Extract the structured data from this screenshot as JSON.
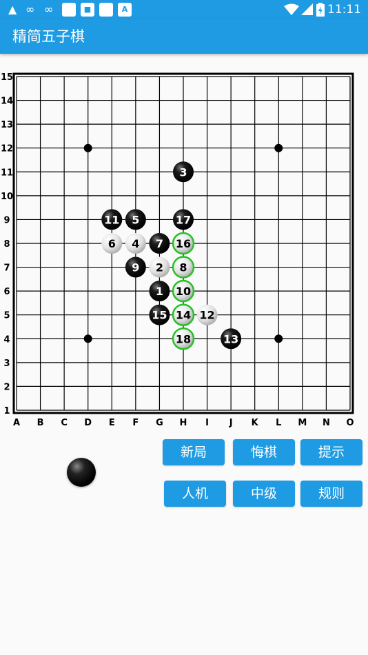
{
  "status_bar": {
    "time": "11:11",
    "left_icons": [
      "qq-icon",
      "infinity-icon",
      "infinity-icon",
      "square-app-icon",
      "robot-app-icon",
      "square-app-icon",
      "a-app-icon"
    ],
    "right_icons": [
      "wifi-icon",
      "signal-icon",
      "battery-icon"
    ]
  },
  "app": {
    "title": "精简五子棋"
  },
  "board": {
    "size": 15,
    "col_labels": [
      "A",
      "B",
      "C",
      "D",
      "E",
      "F",
      "G",
      "H",
      "I",
      "J",
      "K",
      "L",
      "M",
      "N",
      "O"
    ],
    "row_labels": [
      "15",
      "14",
      "13",
      "12",
      "11",
      "10",
      "9",
      "8",
      "7",
      "6",
      "5",
      "4",
      "3",
      "2",
      "1"
    ],
    "star_points": [
      [
        "D",
        12
      ],
      [
        "L",
        12
      ],
      [
        "D",
        4
      ],
      [
        "L",
        4
      ]
    ],
    "stones": [
      {
        "n": "1",
        "col": "G",
        "row": 6,
        "color": "black"
      },
      {
        "n": "2",
        "col": "G",
        "row": 7,
        "color": "white"
      },
      {
        "n": "3",
        "col": "H",
        "row": 11,
        "color": "black"
      },
      {
        "n": "4",
        "col": "F",
        "row": 8,
        "color": "white"
      },
      {
        "n": "5",
        "col": "F",
        "row": 9,
        "color": "black"
      },
      {
        "n": "6",
        "col": "E",
        "row": 8,
        "color": "white"
      },
      {
        "n": "7",
        "col": "G",
        "row": 8,
        "color": "black"
      },
      {
        "n": "8",
        "col": "H",
        "row": 7,
        "color": "white",
        "highlight": true
      },
      {
        "n": "9",
        "col": "F",
        "row": 7,
        "color": "black"
      },
      {
        "n": "10",
        "col": "H",
        "row": 6,
        "color": "white",
        "highlight": true
      },
      {
        "n": "11",
        "col": "E",
        "row": 9,
        "color": "black"
      },
      {
        "n": "12",
        "col": "I",
        "row": 5,
        "color": "white"
      },
      {
        "n": "13",
        "col": "J",
        "row": 4,
        "color": "black"
      },
      {
        "n": "14",
        "col": "H",
        "row": 5,
        "color": "white",
        "highlight": true
      },
      {
        "n": "15",
        "col": "G",
        "row": 5,
        "color": "black"
      },
      {
        "n": "16",
        "col": "H",
        "row": 8,
        "color": "white",
        "highlight": true
      },
      {
        "n": "17",
        "col": "H",
        "row": 9,
        "color": "black"
      },
      {
        "n": "18",
        "col": "H",
        "row": 4,
        "color": "white",
        "highlight": true
      }
    ],
    "highlight_color": "#22c322"
  },
  "controls": {
    "new_game": "新局",
    "undo": "悔棋",
    "hint": "提示",
    "mode": "人机",
    "level": "中级",
    "rules": "规则"
  },
  "current_turn": "black",
  "colors": {
    "primary": "#1e9be3",
    "background": "#fafafa"
  }
}
